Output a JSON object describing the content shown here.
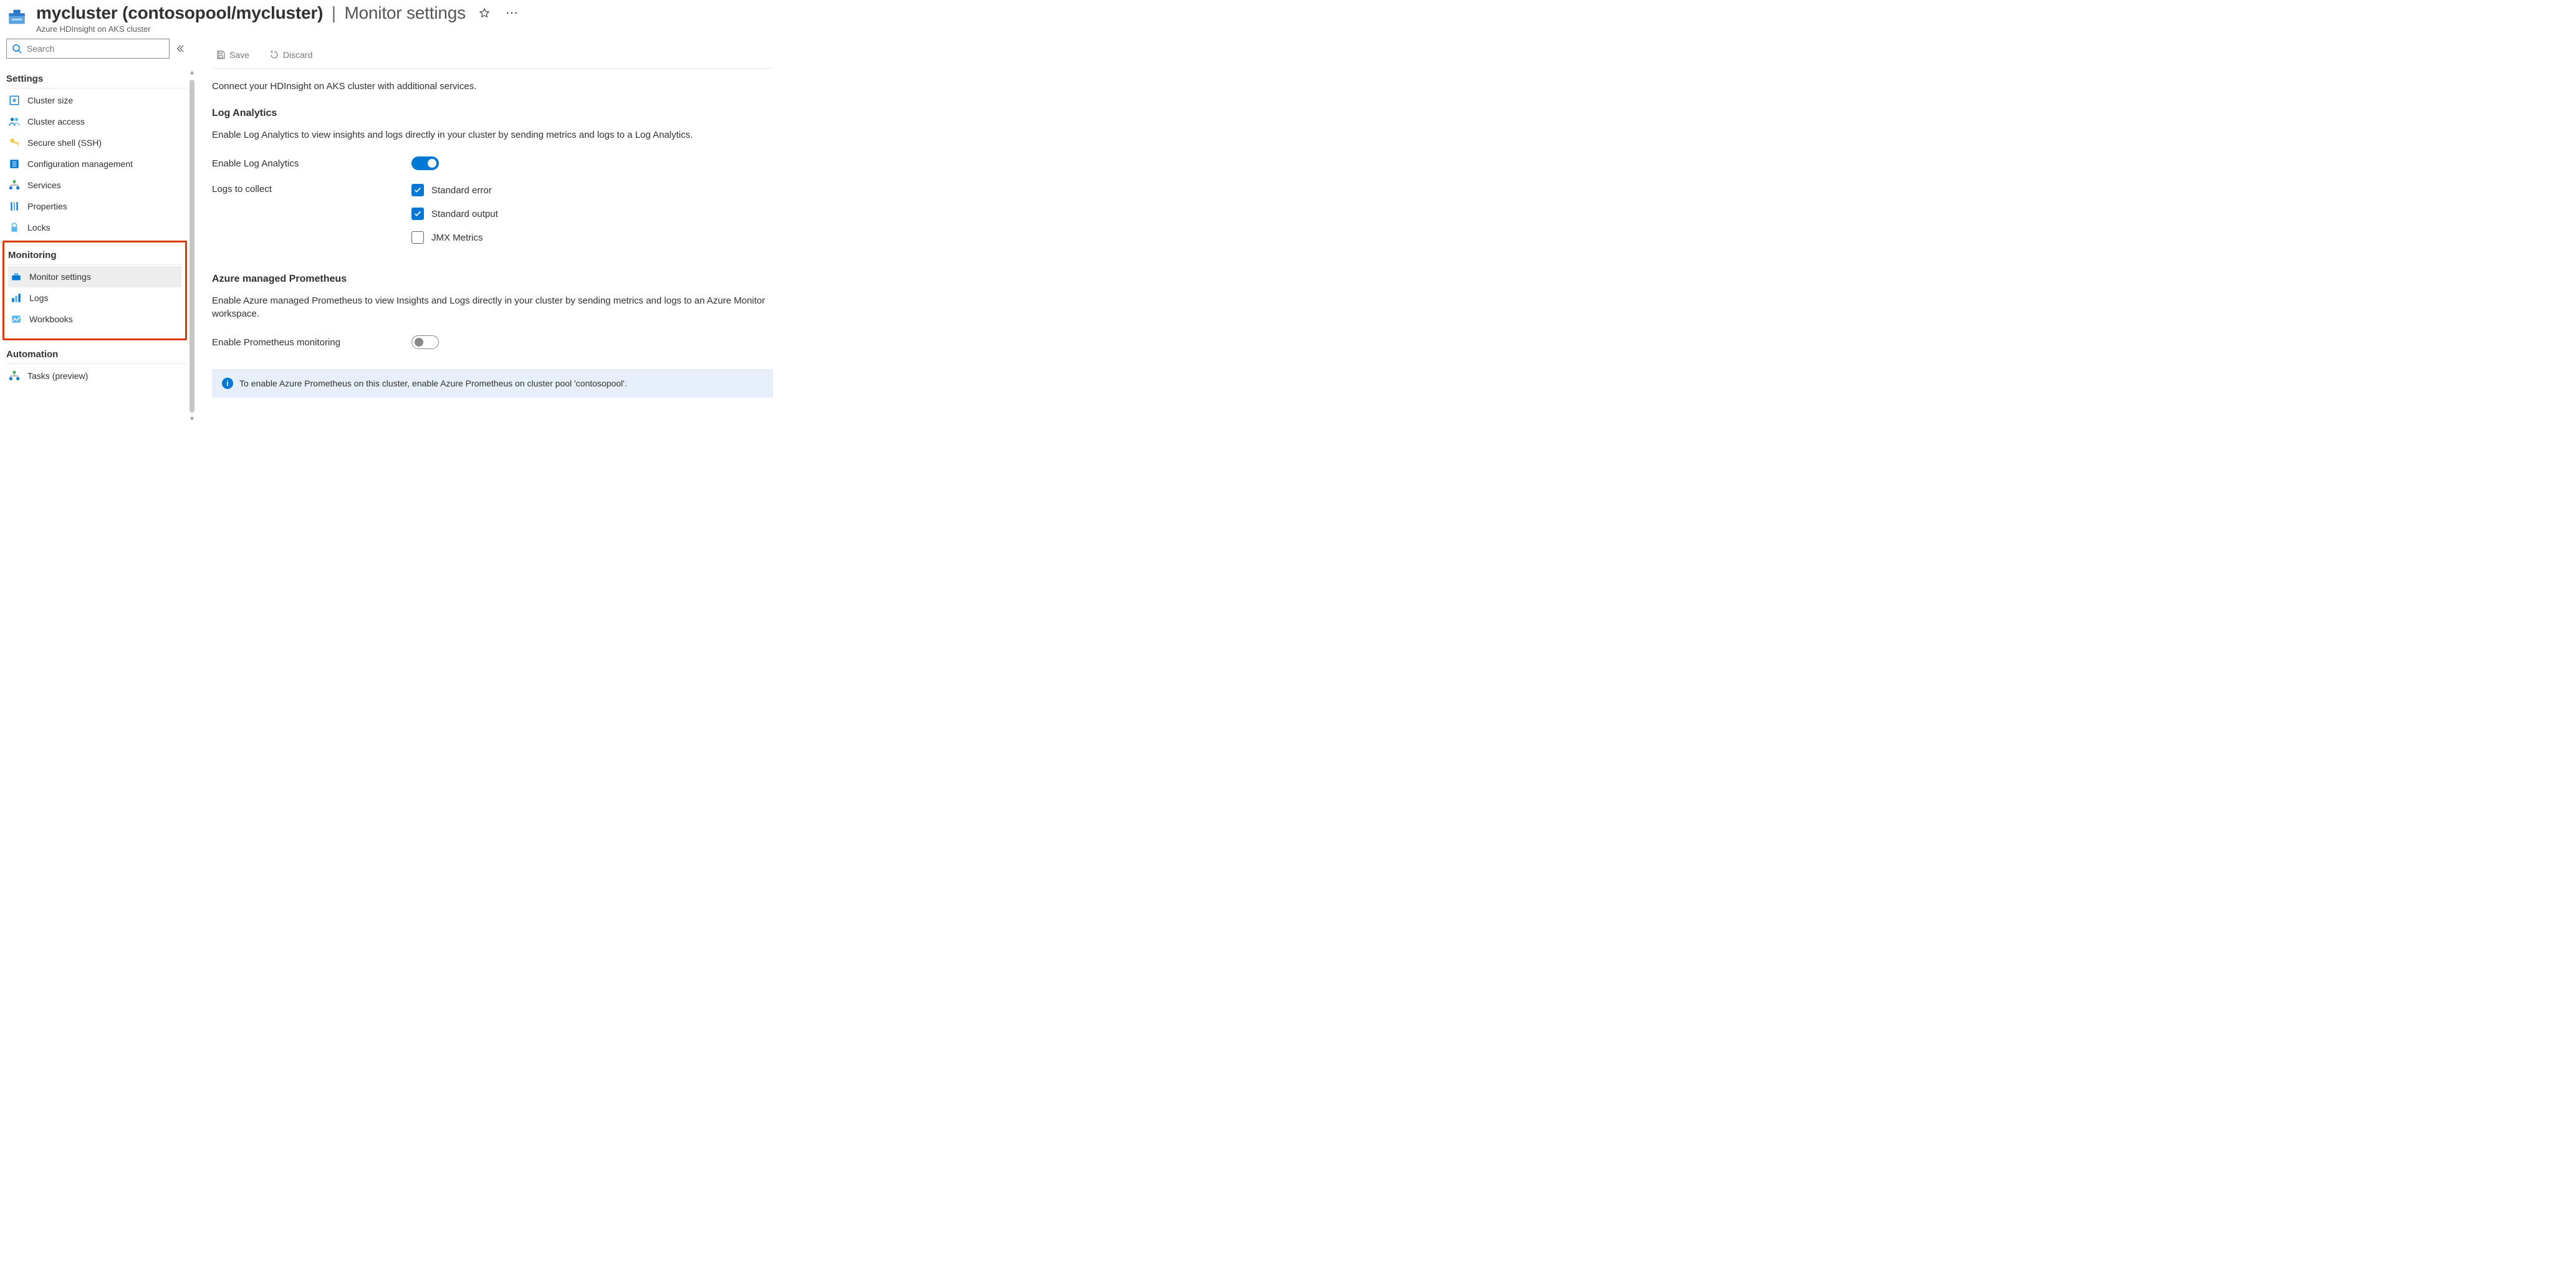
{
  "header": {
    "resource_name": "mycluster (contosopool/mycluster)",
    "page_name": "Monitor settings",
    "subtitle": "Azure HDInsight on AKS cluster"
  },
  "search": {
    "placeholder": "Search"
  },
  "sidebar": {
    "sections": [
      {
        "title": "Settings",
        "items": [
          {
            "label": "Cluster size",
            "icon": "cluster-size-icon"
          },
          {
            "label": "Cluster access",
            "icon": "cluster-access-icon"
          },
          {
            "label": "Secure shell (SSH)",
            "icon": "key-icon"
          },
          {
            "label": "Configuration management",
            "icon": "config-icon"
          },
          {
            "label": "Services",
            "icon": "services-icon"
          },
          {
            "label": "Properties",
            "icon": "properties-icon"
          },
          {
            "label": "Locks",
            "icon": "lock-icon"
          }
        ]
      },
      {
        "title": "Monitoring",
        "highlighted": true,
        "items": [
          {
            "label": "Monitor settings",
            "icon": "monitor-settings-icon",
            "selected": true
          },
          {
            "label": "Logs",
            "icon": "logs-icon"
          },
          {
            "label": "Workbooks",
            "icon": "workbooks-icon"
          }
        ]
      },
      {
        "title": "Automation",
        "items": [
          {
            "label": "Tasks (preview)",
            "icon": "tasks-icon"
          }
        ]
      }
    ]
  },
  "commands": {
    "save": "Save",
    "discard": "Discard"
  },
  "main": {
    "intro": "Connect your HDInsight on AKS cluster with additional services.",
    "log_analytics": {
      "heading": "Log Analytics",
      "text": "Enable Log Analytics to view insights and logs directly in your cluster by sending metrics and logs to a Log Analytics.",
      "toggle_label": "Enable Log Analytics",
      "toggle_on": true,
      "collect_label": "Logs to collect",
      "options": [
        {
          "label": "Standard error",
          "checked": true
        },
        {
          "label": "Standard output",
          "checked": true
        },
        {
          "label": "JMX Metrics",
          "checked": false
        }
      ]
    },
    "prometheus": {
      "heading": "Azure managed Prometheus",
      "text": "Enable Azure managed Prometheus to view Insights and Logs directly in your cluster by sending metrics and logs to an Azure Monitor workspace.",
      "toggle_label": "Enable Prometheus monitoring",
      "toggle_on": false,
      "info": "To enable Azure Prometheus on this cluster, enable Azure Prometheus on cluster pool 'contosopool'."
    }
  }
}
